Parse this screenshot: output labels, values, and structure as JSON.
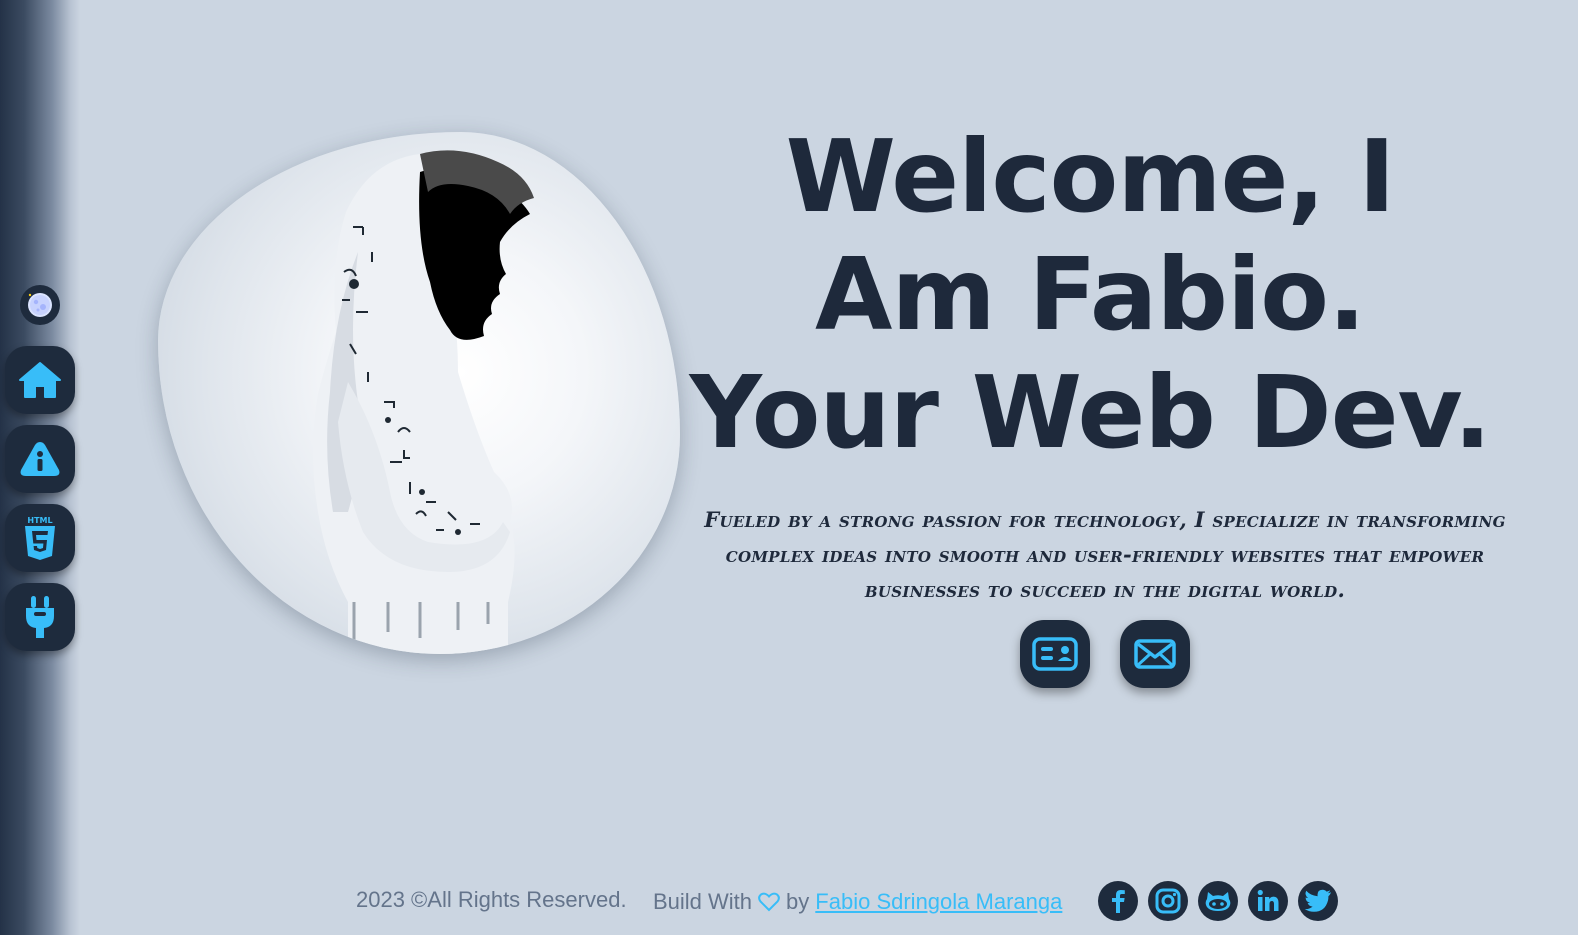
{
  "colors": {
    "background": "#cbd5e1",
    "dark": "#1e2b3d",
    "accent": "#38bdf8",
    "text": "#1e293b",
    "muted": "#64748b"
  },
  "sidebar": {
    "theme_toggle_icon": "moon-icon",
    "items": [
      {
        "name": "home",
        "icon": "home-icon"
      },
      {
        "name": "about",
        "icon": "info-icon"
      },
      {
        "name": "skills",
        "icon": "html5-icon"
      },
      {
        "name": "services",
        "icon": "plug-icon"
      }
    ]
  },
  "hero": {
    "headline_line1": "Welcome, I",
    "headline_line2": "Am Fabio.",
    "headline_line3": "Your Web Dev.",
    "subtitle": "Fueled by a strong passion for technology, I specialize in transforming complex ideas into smooth and user-friendly websites that empower businesses to succeed in the digital world.",
    "cta": [
      {
        "name": "resume",
        "icon": "id-card-icon"
      },
      {
        "name": "contact",
        "icon": "envelope-icon"
      }
    ]
  },
  "footer": {
    "copyright": "2023 ©All Rights Reserved.",
    "built_with": "Build With",
    "by": "by",
    "author": "Fabio Sdringola Maranga",
    "socials": [
      "facebook-icon",
      "instagram-icon",
      "github-icon",
      "linkedin-icon",
      "twitter-icon"
    ]
  }
}
